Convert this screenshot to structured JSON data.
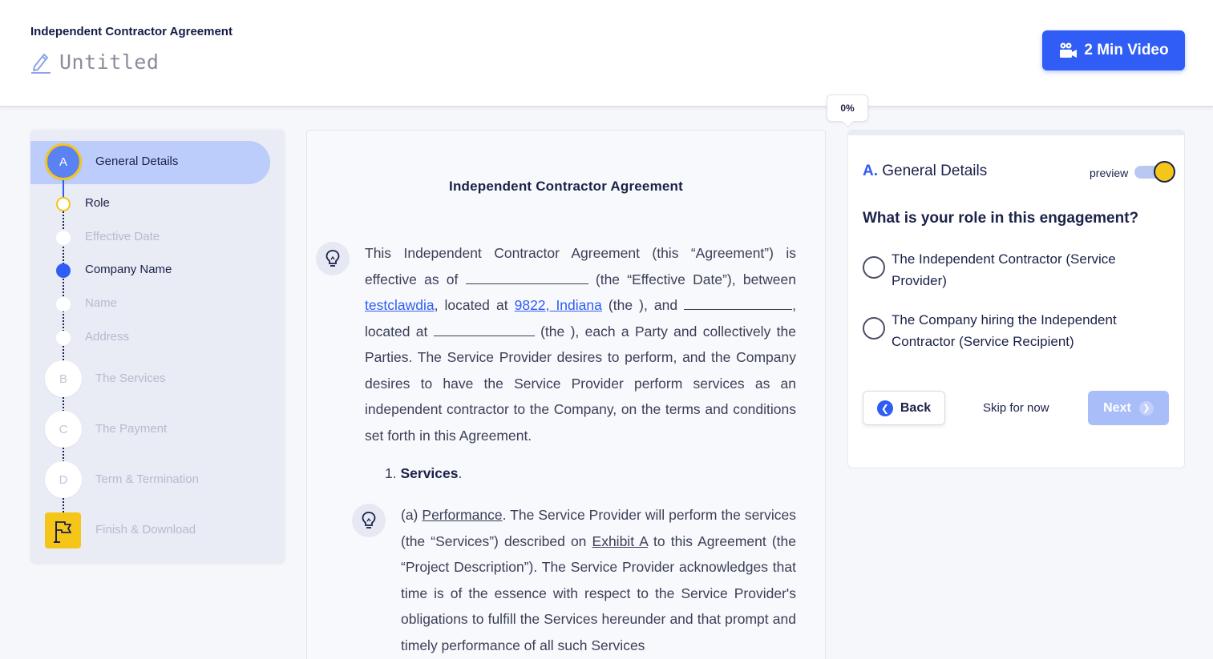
{
  "header": {
    "doc_title": "Independent Contractor Agreement",
    "untitled": "Untitled",
    "video_button": "2 Min Video",
    "progress": "0%"
  },
  "sidebar": {
    "sections": [
      {
        "letter": "A",
        "label": "General Details"
      },
      {
        "letter": "B",
        "label": "The Services"
      },
      {
        "letter": "C",
        "label": "The Payment"
      },
      {
        "letter": "D",
        "label": "Term & Termination"
      },
      {
        "letter": "",
        "label": "Finish & Download"
      }
    ],
    "subitems": [
      "Role",
      "Effective Date",
      "Company Name",
      "Name",
      "Address"
    ]
  },
  "document": {
    "heading": "Independent Contractor Agreement",
    "p1_a": "This Independent Contractor Agreement (this “Agreement”) is effective as of ",
    "p1_b": " (the “Effective Date”), between ",
    "p1_link1": "testclawdia",
    "p1_c": ", located at ",
    "p1_link2": "9822, Indiana",
    "p1_d": " (the ), and ",
    "p1_e": ", located at ",
    "p1_f": " (the ), each a Party and collectively the Parties. The Service Provider desires to perform, and the Company desires to have the Service Provider perform services as an independent contractor to the Company, on the terms and conditions set forth in this Agreement.",
    "services_num": "1.",
    "services_title": "Services",
    "services_dot": ".",
    "p2_a": "(a) ",
    "p2_perf": "Performance",
    "p2_b": ".  The Service Provider will perform the services (the “Services”) described on ",
    "p2_exhibit": "Exhibit A",
    "p2_c": " to this Agreement (the “Project Description”).  The Service Provider acknowledges that time is of the essence with respect to the Service Provider's obligations to fulfill the Services hereunder and that prompt and timely performance of all such Services"
  },
  "panel": {
    "letter": "A.",
    "title": "General Details",
    "preview_label": "preview",
    "question": "What is your role in this engagement?",
    "options": [
      "The Independent Contractor (Service Provider)",
      "The Company hiring the Independent Contractor (Service Recipient)"
    ],
    "back": "Back",
    "skip": "Skip for now",
    "next": "Next"
  },
  "colors": {
    "accent": "#2f5df5",
    "highlight": "#f5c518",
    "active_section_bg": "#bccdfb"
  }
}
